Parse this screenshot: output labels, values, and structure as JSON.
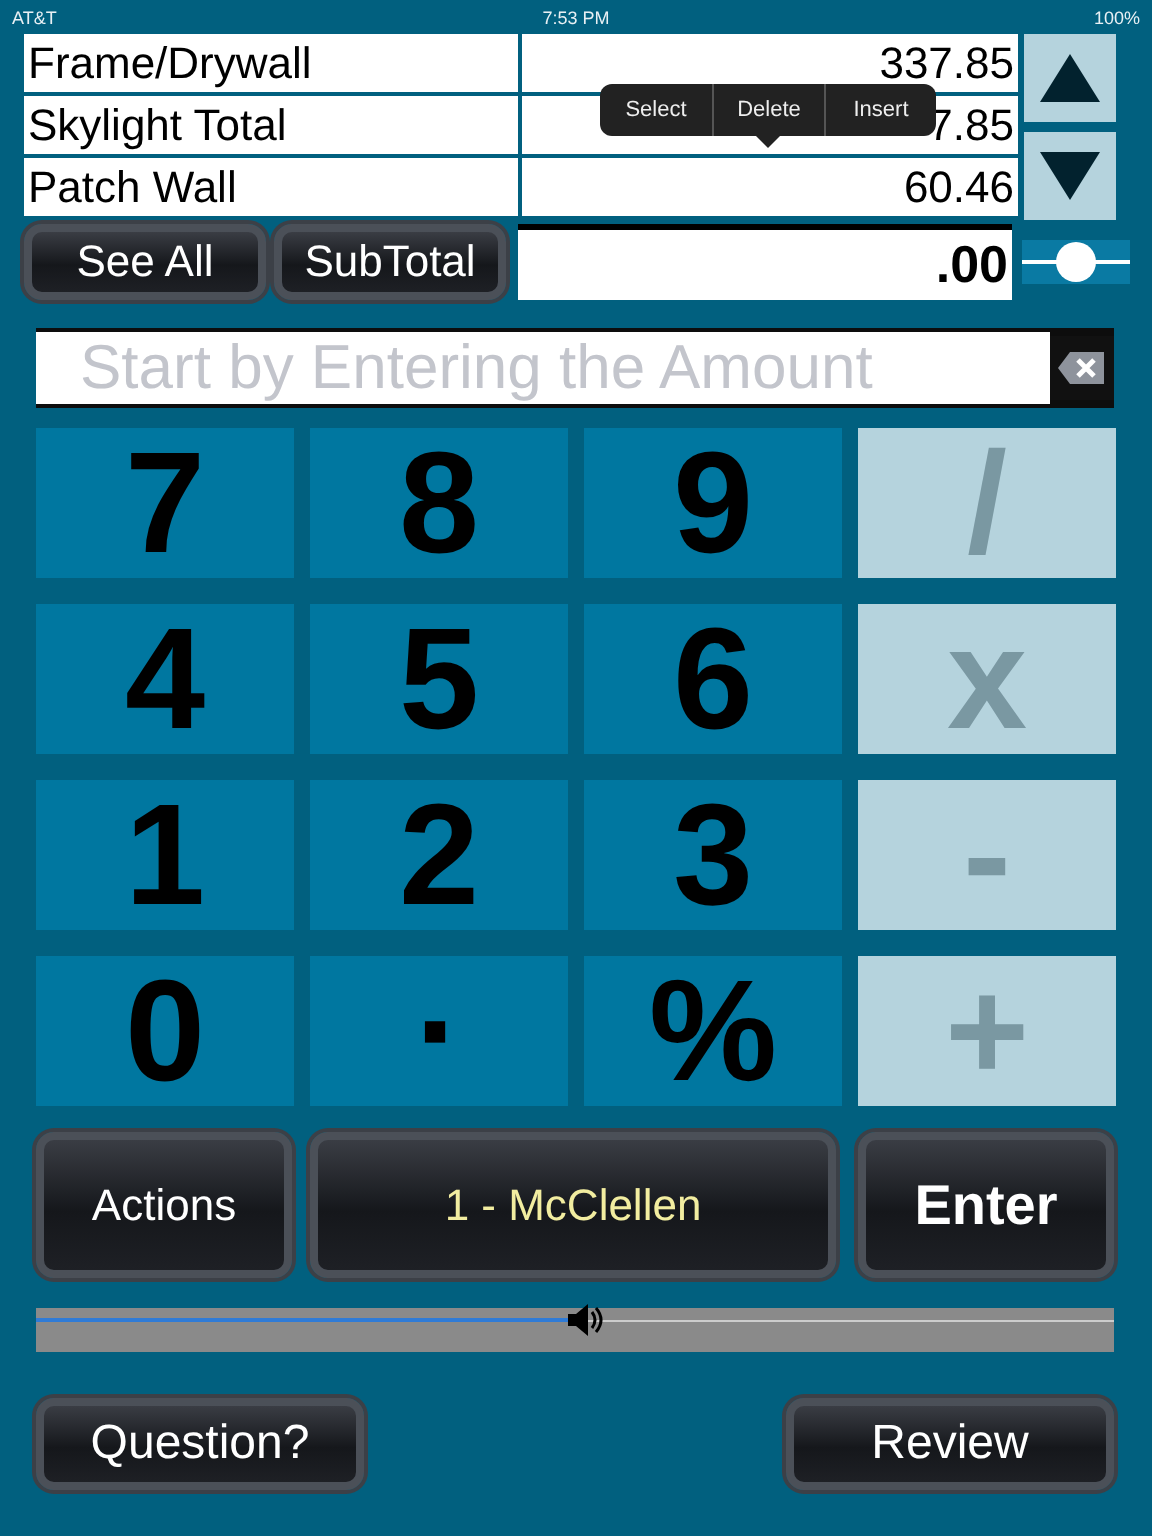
{
  "status_bar": {
    "carrier": "AT&T",
    "time": "7:53 PM",
    "battery": "100%"
  },
  "entries": [
    {
      "label": "Frame/Drywall",
      "value": "337.85"
    },
    {
      "label": "Skylight Total",
      "value": "7.85"
    },
    {
      "label": "Patch Wall",
      "value": "60.46"
    }
  ],
  "edit_menu": [
    "Select",
    "Delete",
    "Insert"
  ],
  "summary": {
    "buttons": [
      "See All",
      "SubTotal"
    ],
    "total": ".00",
    "slider": {
      "level": 0.5
    }
  },
  "amount_field": {
    "placeholder": "Start by Entering the Amount"
  },
  "keypad": [
    {
      "label": "7",
      "kind": "digit"
    },
    {
      "label": "8",
      "kind": "digit"
    },
    {
      "label": "9",
      "kind": "digit"
    },
    {
      "label": "/",
      "kind": "operator"
    },
    {
      "label": "4",
      "kind": "digit"
    },
    {
      "label": "5",
      "kind": "digit"
    },
    {
      "label": "6",
      "kind": "digit"
    },
    {
      "label": "x",
      "kind": "operator"
    },
    {
      "label": "1",
      "kind": "digit"
    },
    {
      "label": "2",
      "kind": "digit"
    },
    {
      "label": "3",
      "kind": "digit"
    },
    {
      "label": "-",
      "kind": "operator"
    },
    {
      "label": "0",
      "kind": "digit"
    },
    {
      "label": "·",
      "kind": "digit"
    },
    {
      "label": "%",
      "kind": "digit"
    },
    {
      "label": "+",
      "kind": "operator"
    }
  ],
  "actions": [
    {
      "label": "Actions",
      "kind": "plain"
    },
    {
      "label": "1 - McClellen",
      "kind": "project"
    },
    {
      "label": "Enter",
      "kind": "primary"
    }
  ],
  "volume": {
    "level": 0.51
  },
  "footer": [
    "Question?",
    "Review"
  ]
}
